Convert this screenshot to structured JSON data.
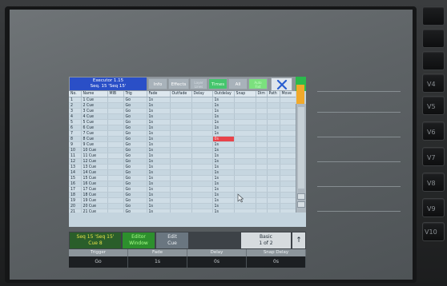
{
  "hardware_keys": [
    "V4",
    "V5",
    "V6",
    "V7",
    "V8",
    "V9",
    "V10"
  ],
  "window": {
    "title_line1": "Executor 1.15",
    "title_line2": "Seq. 15 'Seq 15'",
    "toolbar": {
      "info": "Info",
      "effects": "Effects",
      "layer_top": "Layer",
      "layer_bottom": "Lines",
      "times": "Times",
      "all": "All",
      "auto_top": "Auto",
      "auto_bottom": "Fixt"
    }
  },
  "table": {
    "columns": [
      "No.",
      "Name",
      "MIB",
      "Trig",
      "Fade",
      "Outfade",
      "Delay",
      "Outdelay",
      "Snap",
      "Dim",
      "Path",
      "Move"
    ],
    "rows": [
      {
        "no": "1",
        "name": "1 Cue",
        "trig": "Go",
        "fade": "1s",
        "outdelay": "1s"
      },
      {
        "no": "2",
        "name": "2 Cue",
        "trig": "Go",
        "fade": "1s",
        "outdelay": "1s"
      },
      {
        "no": "3",
        "name": "3 Cue",
        "trig": "Go",
        "fade": "1s",
        "outdelay": "1s"
      },
      {
        "no": "4",
        "name": "4 Cue",
        "trig": "Go",
        "fade": "1s",
        "outdelay": "1s"
      },
      {
        "no": "5",
        "name": "5 Cue",
        "trig": "Go",
        "fade": "1s",
        "outdelay": "1s"
      },
      {
        "no": "6",
        "name": "6 Cue",
        "trig": "Go",
        "fade": "1s",
        "outdelay": "1s"
      },
      {
        "no": "7",
        "name": "7 Cue",
        "trig": "Go",
        "fade": "1s",
        "outdelay": "1s"
      },
      {
        "no": "8",
        "name": "8 Cue",
        "trig": "Go",
        "fade": "1s",
        "outdelay": "0s"
      },
      {
        "no": "9",
        "name": "9 Cue",
        "trig": "Go",
        "fade": "1s",
        "outdelay": "1s"
      },
      {
        "no": "10",
        "name": "10 Cue",
        "trig": "Go",
        "fade": "1s",
        "outdelay": "1s"
      },
      {
        "no": "11",
        "name": "11 Cue",
        "trig": "Go",
        "fade": "1s",
        "outdelay": "1s"
      },
      {
        "no": "12",
        "name": "12 Cue",
        "trig": "Go",
        "fade": "1s",
        "outdelay": "1s"
      },
      {
        "no": "13",
        "name": "13 Cue",
        "trig": "Go",
        "fade": "1s",
        "outdelay": "1s"
      },
      {
        "no": "14",
        "name": "14 Cue",
        "trig": "Go",
        "fade": "1s",
        "outdelay": "1s"
      },
      {
        "no": "15",
        "name": "15 Cue",
        "trig": "Go",
        "fade": "1s",
        "outdelay": "1s"
      },
      {
        "no": "16",
        "name": "16 Cue",
        "trig": "Go",
        "fade": "1s",
        "outdelay": "1s"
      },
      {
        "no": "17",
        "name": "17 Cue",
        "trig": "Go",
        "fade": "1s",
        "outdelay": "1s"
      },
      {
        "no": "18",
        "name": "18 Cue",
        "trig": "Go",
        "fade": "1s",
        "outdelay": "1s"
      },
      {
        "no": "19",
        "name": "19 Cue",
        "trig": "Go",
        "fade": "1s",
        "outdelay": "1s"
      },
      {
        "no": "20",
        "name": "20 Cue",
        "trig": "Go",
        "fade": "1s",
        "outdelay": "1s"
      },
      {
        "no": "21",
        "name": "21 Cue",
        "trig": "Go",
        "fade": "1s",
        "outdelay": "1s"
      }
    ],
    "highlight_color": "#e8434a"
  },
  "bottombar": {
    "seq_line1": "Seq 15 'Seq 15'",
    "seq_line2": "Cue 8",
    "editor_line1": "Editor",
    "editor_line2": "Window",
    "edit_line1": "Edit",
    "edit_line2": "Cue",
    "basic_line1": "Basic",
    "basic_line2": "1 of 2",
    "arrow": "↑"
  },
  "encoders": [
    {
      "label": "Trigger",
      "value": "Go"
    },
    {
      "label": "Fade",
      "value": "1s"
    },
    {
      "label": "Delay",
      "value": "0s"
    },
    {
      "label": "Snap Delay",
      "value": "0s"
    }
  ]
}
